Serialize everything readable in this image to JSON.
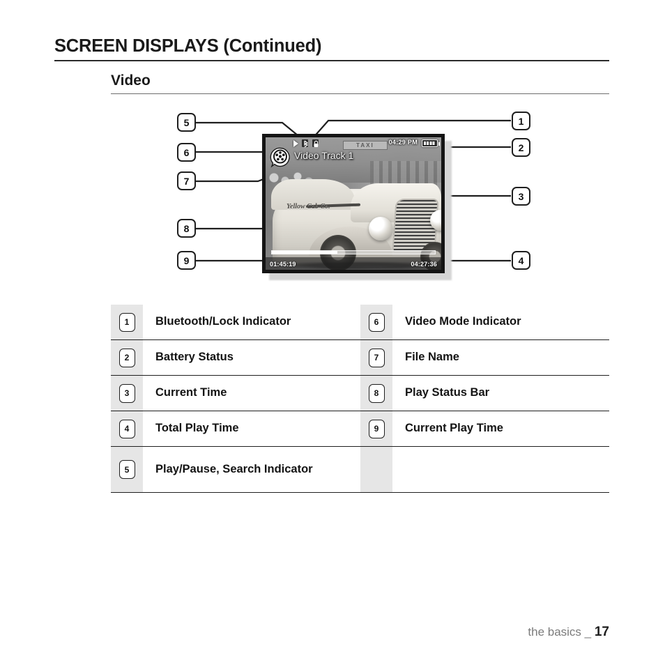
{
  "header": {
    "title": "SCREEN DISPLAYS (Continued)",
    "section": "Video"
  },
  "device_screen": {
    "status_icons": [
      "play-icon",
      "bluetooth-icon",
      "lock-icon"
    ],
    "current_time": "04:29 PM",
    "battery": "battery-full-icon",
    "mode_icon": "video-mode-icon",
    "file_name": "Video Track 1",
    "progress_percent": 40,
    "current_play_time": "01:45:19",
    "total_play_time": "04:27:36",
    "photo_caption": "Yellow Cab Co.",
    "photo_sign": "TAXI"
  },
  "callouts": {
    "left": [
      "5",
      "6",
      "7",
      "8",
      "9"
    ],
    "right": [
      "1",
      "2",
      "3",
      "4"
    ]
  },
  "legend": {
    "rows": [
      {
        "left_num": "1",
        "left_label": "Bluetooth/Lock Indicator",
        "right_num": "6",
        "right_label": "Video Mode Indicator"
      },
      {
        "left_num": "2",
        "left_label": "Battery Status",
        "right_num": "7",
        "right_label": "File Name"
      },
      {
        "left_num": "3",
        "left_label": "Current Time",
        "right_num": "8",
        "right_label": "Play Status Bar"
      },
      {
        "left_num": "4",
        "left_label": "Total Play Time",
        "right_num": "9",
        "right_label": "Current Play Time"
      },
      {
        "left_num": "5",
        "left_label": "Play/Pause, Search Indicator",
        "right_num": "",
        "right_label": ""
      }
    ]
  },
  "footer": {
    "text": "the basics _",
    "page": "17"
  },
  "colors": {
    "rule": "#2b2b2b",
    "num_col_bg": "#e6e6e6",
    "text": "#141414",
    "footer_text": "#7b7b7b"
  }
}
